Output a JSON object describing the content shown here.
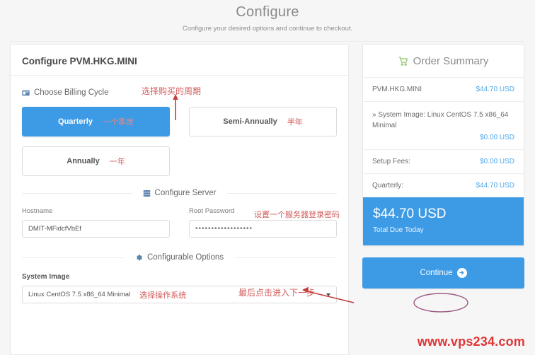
{
  "page": {
    "title": "Configure",
    "subtitle": "Configure your desired options and continue to checkout."
  },
  "configure": {
    "heading": "Configure PVM.HKG.MINI",
    "billing": {
      "icon": "credit-card-icon",
      "label": "Choose Billing Cycle",
      "options": [
        {
          "label": "Quarterly",
          "note": "一个季度",
          "selected": true
        },
        {
          "label": "Semi-Annually",
          "note": "半年",
          "selected": false
        },
        {
          "label": "Annually",
          "note": "一年",
          "selected": false
        }
      ]
    },
    "server": {
      "icon": "server-icon",
      "label": "Configure Server",
      "hostname_label": "Hostname",
      "hostname_value": "DMIT-MFidcfVbEf",
      "password_label": "Root Password",
      "password_value": "••••••••••••••••••",
      "password_note": "设置一个服务器登录密码"
    },
    "options": {
      "icon": "gear-icon",
      "label": "Configurable Options",
      "system_image_label": "System Image",
      "system_image_value": "Linux CentOS 7.5 x86_64 Minimal",
      "system_image_note": "选择操作系统",
      "caret": "chevron-down-icon"
    }
  },
  "summary": {
    "icon": "shopping-cart-icon",
    "title": "Order Summary",
    "rows": [
      {
        "desc": "PVM.HKG.MINI",
        "price": "$44.70 USD",
        "stacked": false
      },
      {
        "desc": "» System Image: Linux CentOS 7.5 x86_64 Minimal",
        "price": "$0.00 USD",
        "stacked": true
      },
      {
        "desc": "Setup Fees:",
        "price": "$0.00 USD",
        "stacked": false
      },
      {
        "desc": "Quarterly:",
        "price": "$44.70 USD",
        "stacked": false
      }
    ],
    "total_amount": "$44.70 USD",
    "total_caption": "Total Due Today",
    "continue_label": "Continue",
    "continue_icon": "arrow-right-icon"
  },
  "annotations": {
    "billing_cycle": "选择购买的周期",
    "continue_step": "最后点击进入下一步",
    "watermark": "www.vps234.com"
  },
  "colors": {
    "accent_blue": "#3d9ae5",
    "price_blue": "#52a8e8",
    "annotation_red": "#d25b5b",
    "watermark_red": "#e03535",
    "cart_green": "#7dbb52",
    "page_bg": "#f6f6f7"
  }
}
